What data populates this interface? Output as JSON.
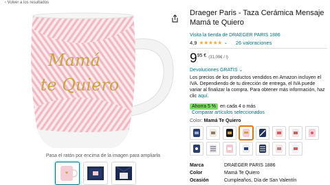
{
  "nav": {
    "back_label": "‹ Volver a los resultados"
  },
  "product": {
    "title": "Draeger Paris - Taza Cerámica Mensaje Mamá te Quiero",
    "store_link": "Visita la tienda de DRAEGER PARIS 1886",
    "rating_value": "4,9",
    "rating_stars": "★★★★★",
    "reviews_count": "26 valoraciones",
    "mug_text_line1": "Mamá",
    "mug_text_line2": "te Quiero"
  },
  "price": {
    "whole": "9",
    "fraction": "95 €",
    "unit_price": "(31,09€ / l)"
  },
  "returns": {
    "label": "Devoluciones GRATIS",
    "chevron": "⌄"
  },
  "tax_note": {
    "text": "Los precios de los productos vendidos en Amazon incluyen el IVA. Dependiendo de tu dirección de entrega, el IVA puede variar al finalizar la compra. Para obtener más información, haz clic",
    "link": "aquí."
  },
  "savings": {
    "badge": "Ahorra 5 %",
    "text": "en cada 4 o más"
  },
  "compare_link": "Comparar artículos seleccionados",
  "color": {
    "label": "Color:",
    "value": "Mamá Te Quiero"
  },
  "gallery": {
    "hint": "Pasa el ratón por encima de la imagen para ampliarla"
  },
  "details": [
    {
      "key": "Marca",
      "value": "DRAEGER PARIS 1886"
    },
    {
      "key": "Color",
      "value": "Mamá Te Quiero"
    },
    {
      "key": "Ocasión",
      "value": "Cumpleaños, Día de San Valentín"
    }
  ],
  "colors": {
    "accent": "#007185",
    "star": "#f3a847",
    "badge": "#7fda69",
    "mug_pink": "#f2c4cc",
    "gold": "#c9a24a"
  }
}
